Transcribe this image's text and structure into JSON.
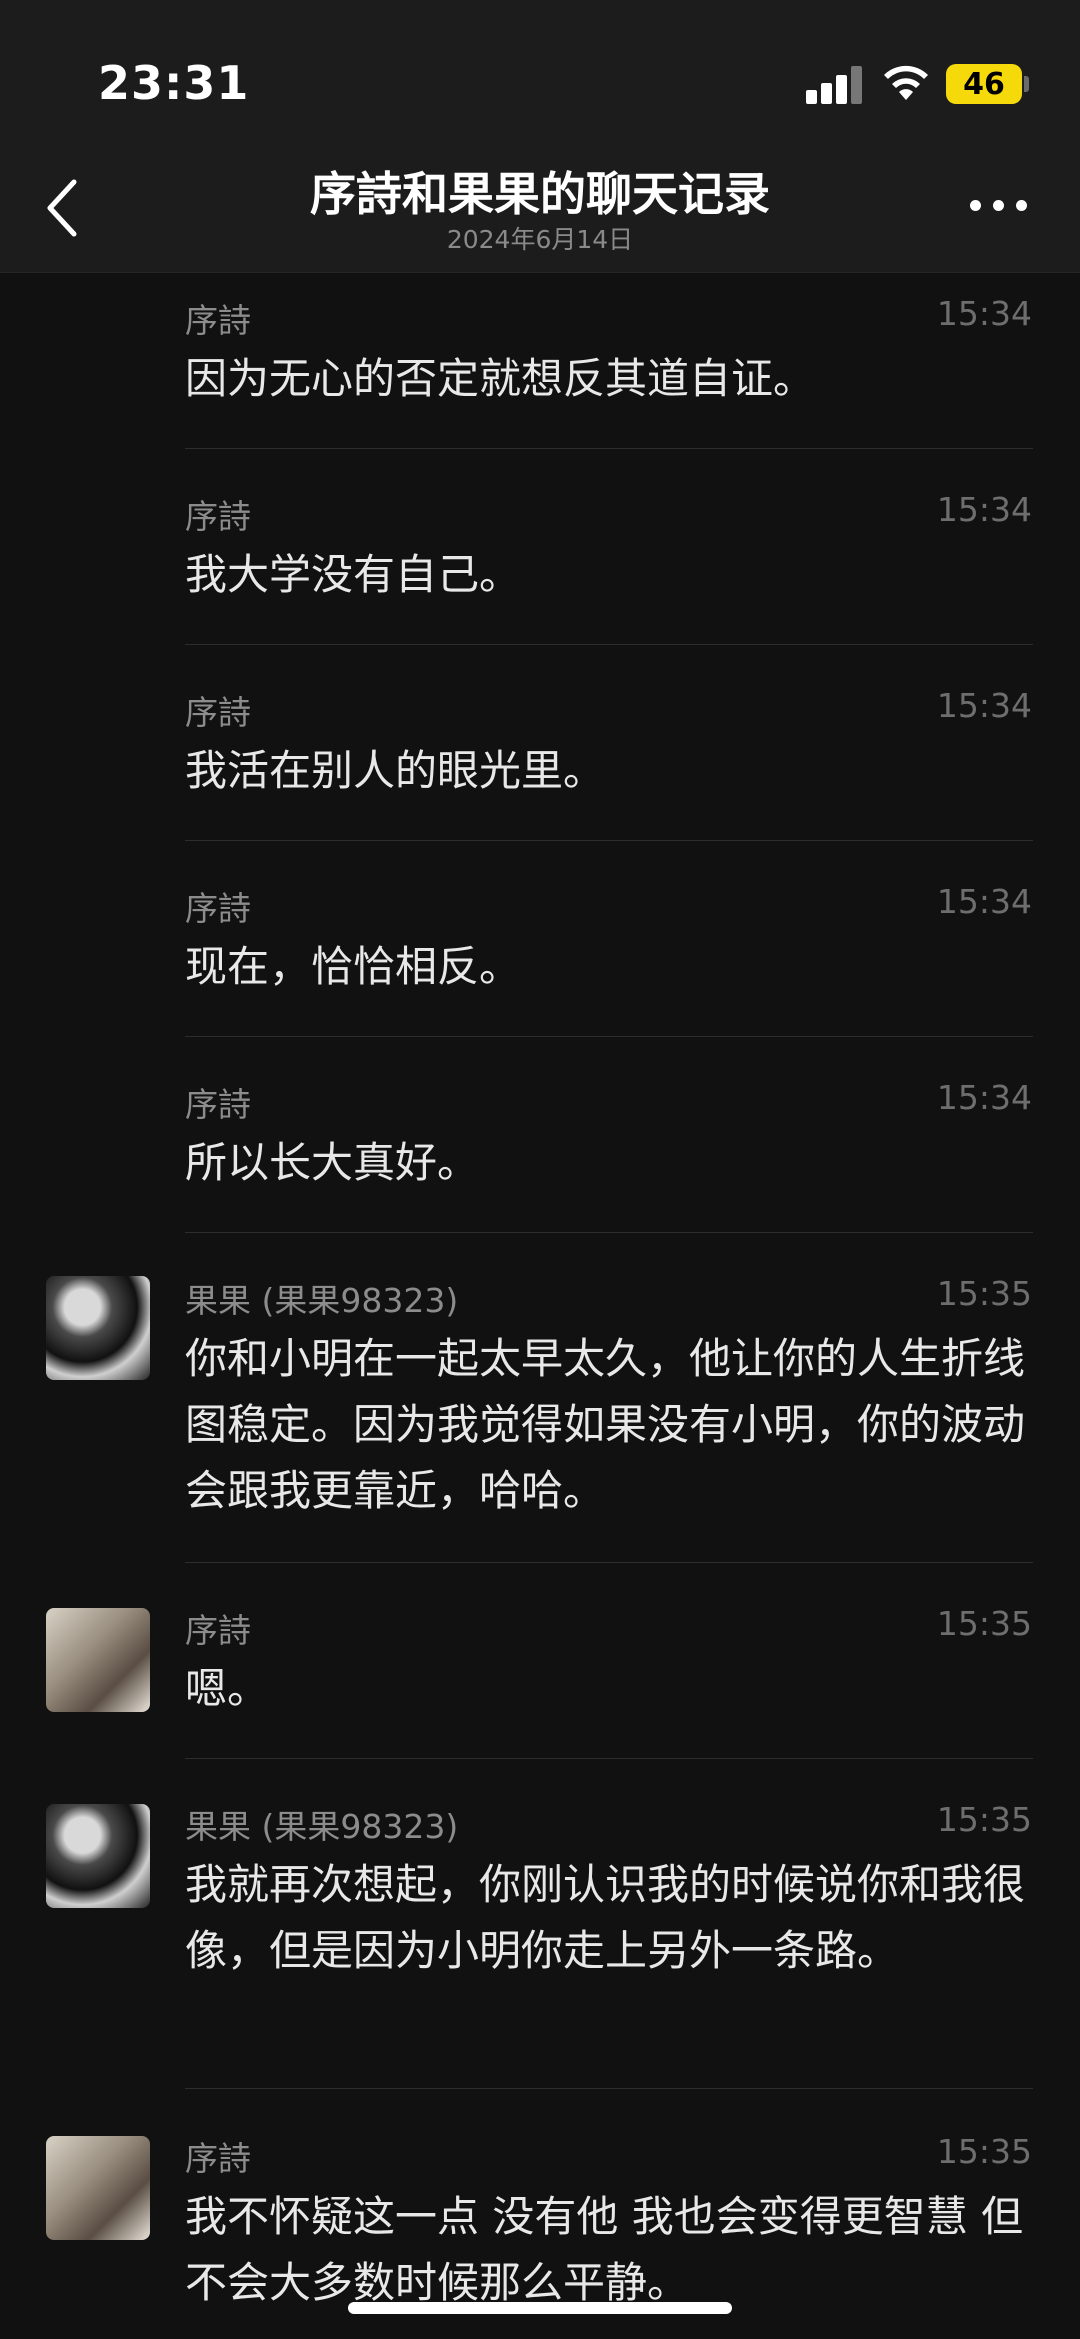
{
  "status_bar": {
    "time": "23:31",
    "battery": "46"
  },
  "header": {
    "title": "序詩和果果的聊天记录",
    "date": "2024年6月14日"
  },
  "messages": [
    {
      "sender": "序詩",
      "time": "15:34",
      "text": "因为无心的否定就想反其道自证。",
      "avatar": "none"
    },
    {
      "sender": "序詩",
      "time": "15:34",
      "text": "我大学没有自己。",
      "avatar": "none"
    },
    {
      "sender": "序詩",
      "time": "15:34",
      "text": "我活在别人的眼光里。",
      "avatar": "none"
    },
    {
      "sender": "序詩",
      "time": "15:34",
      "text": "现在，恰恰相反。",
      "avatar": "none"
    },
    {
      "sender": "序詩",
      "time": "15:34",
      "text": "所以长大真好。",
      "avatar": "none"
    },
    {
      "sender": "果果 (果果98323)",
      "time": "15:35",
      "text": "你和小明在一起太早太久，他让你的人生折线图稳定。因为我觉得如果没有小明，你的波动会跟我更靠近，哈哈。",
      "avatar": "guoguo"
    },
    {
      "sender": "序詩",
      "time": "15:35",
      "text": "嗯。",
      "avatar": "xushi"
    },
    {
      "sender": "果果 (果果98323)",
      "time": "15:35",
      "text": "我就再次想起，你刚认识我的时候说你和我很像，但是因为小明你走上另外一条路。",
      "avatar": "guoguo"
    },
    {
      "sender": "序詩",
      "time": "15:35",
      "text": "我不怀疑这一点 没有他 我也会变得更智慧 但不会大多数时候那么平静。",
      "avatar": "xushi"
    }
  ]
}
